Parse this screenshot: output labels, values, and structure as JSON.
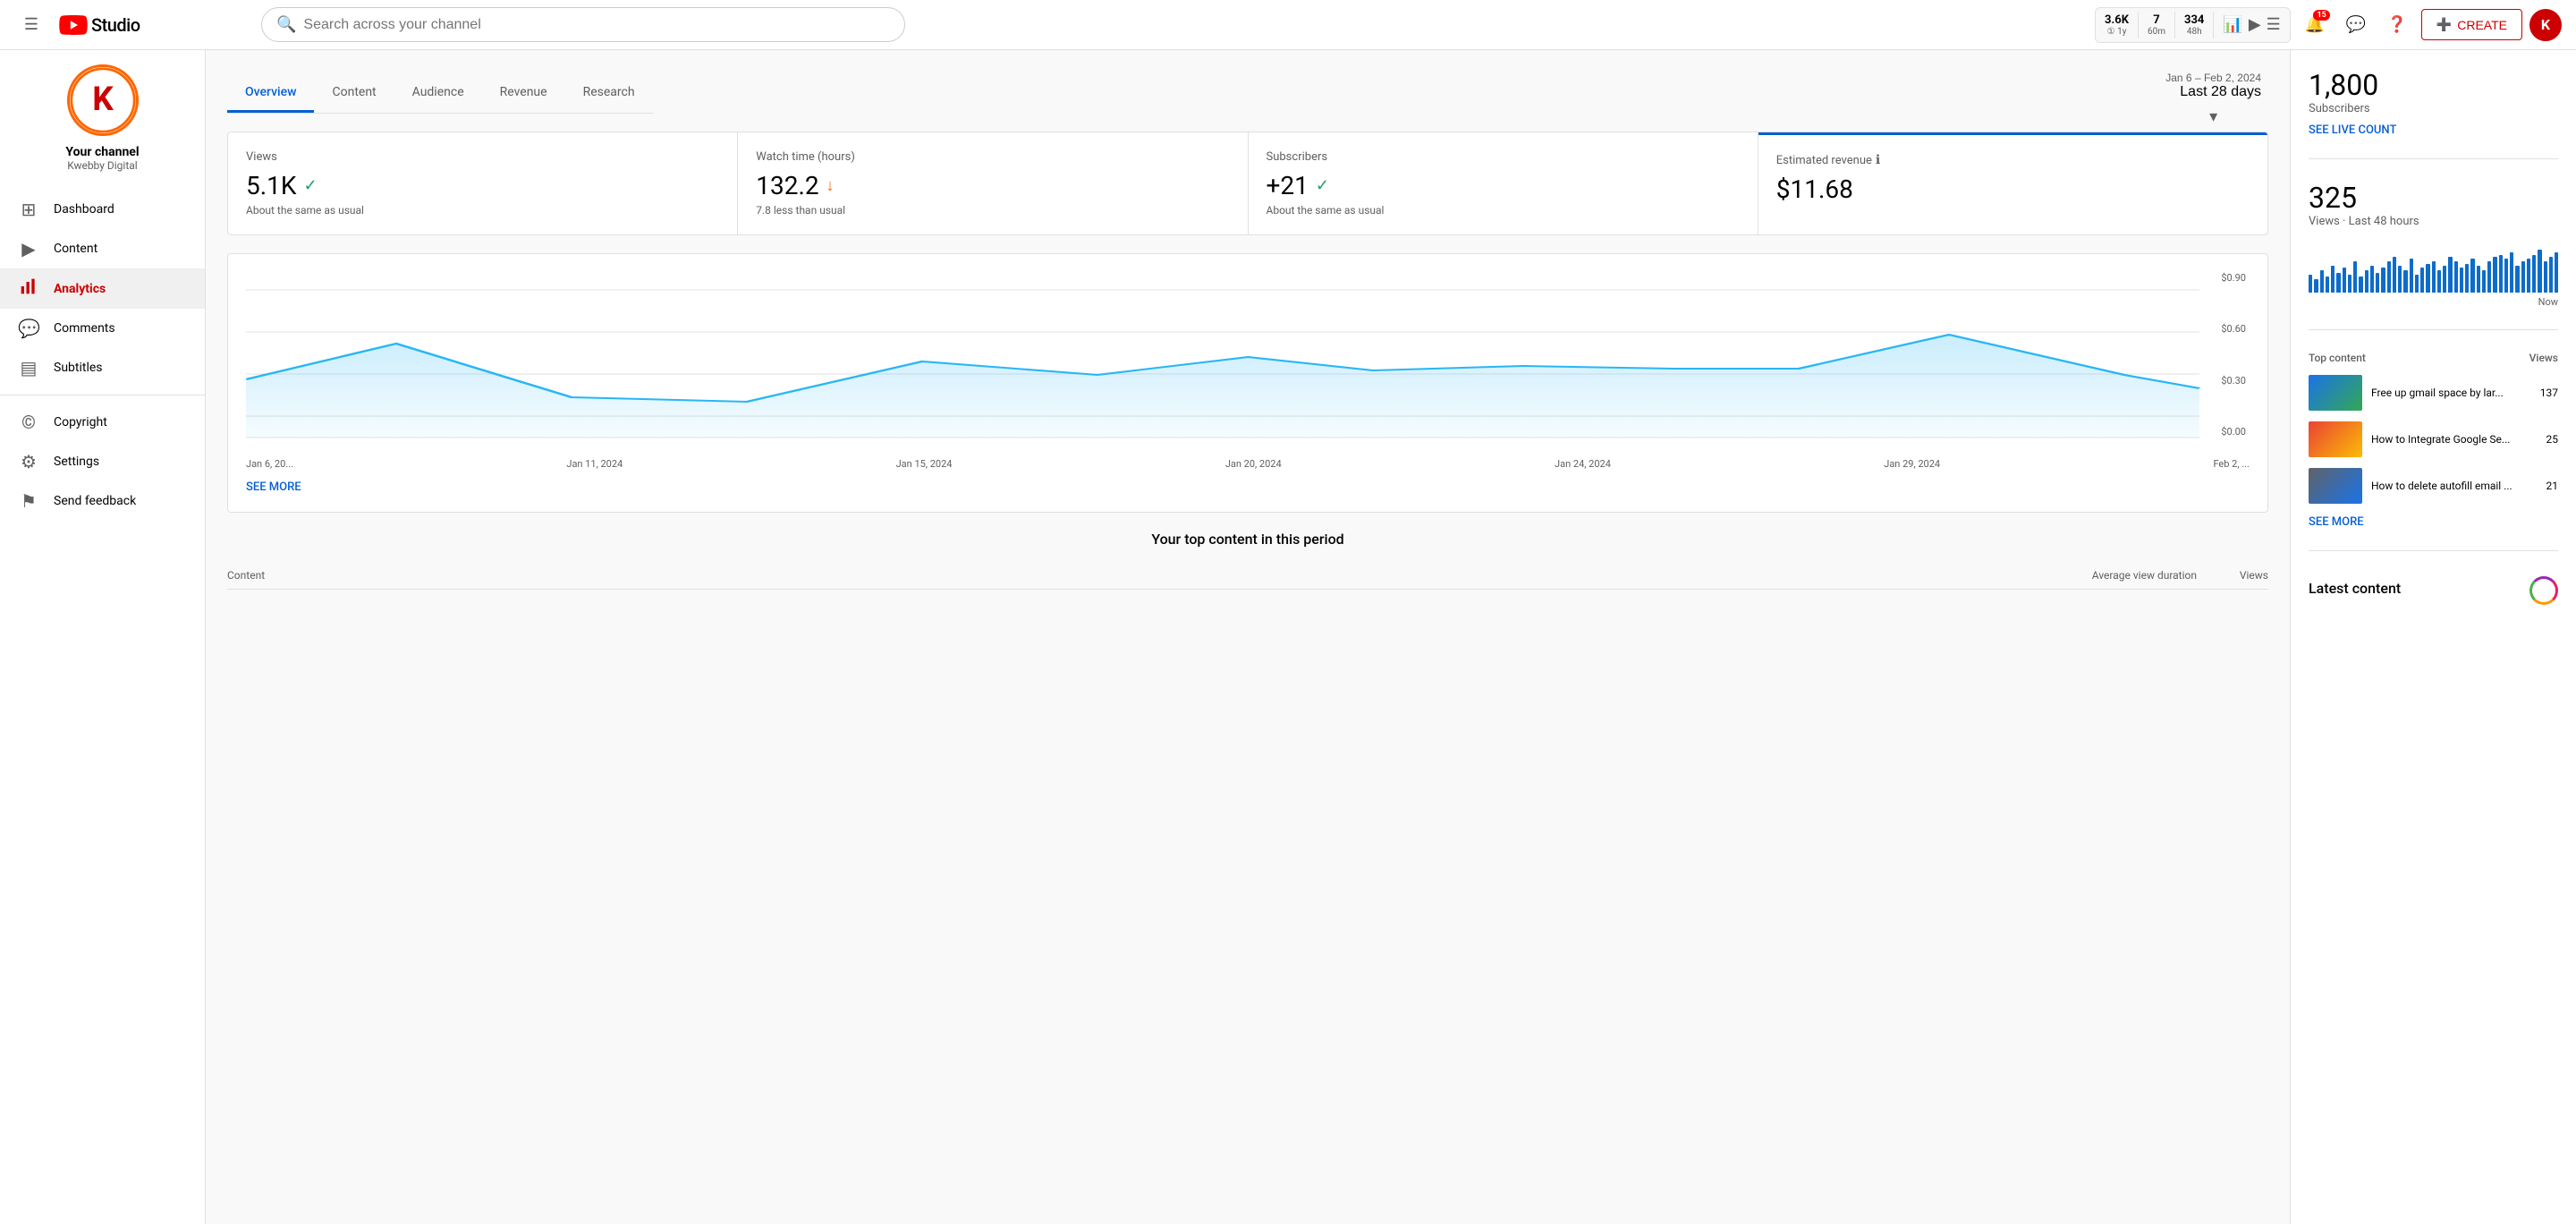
{
  "header": {
    "logo_text": "Studio",
    "search_placeholder": "Search across your channel",
    "stats": {
      "views": "3.6K",
      "views_sub": "① 1y",
      "watch": "7",
      "watch_sub": "60m",
      "notifications": "334",
      "notifications_sub": "48h"
    },
    "notification_count": "15",
    "create_label": "CREATE"
  },
  "channel": {
    "name": "Your channel",
    "handle": "Kwebby Digital",
    "avatar_letter": "K"
  },
  "sidebar": {
    "items": [
      {
        "id": "dashboard",
        "label": "Dashboard",
        "icon": "⊞"
      },
      {
        "id": "content",
        "label": "Content",
        "icon": "▶"
      },
      {
        "id": "analytics",
        "label": "Analytics",
        "icon": "📊"
      },
      {
        "id": "comments",
        "label": "Comments",
        "icon": "💬"
      },
      {
        "id": "subtitles",
        "label": "Subtitles",
        "icon": "▤"
      },
      {
        "id": "copyright",
        "label": "Copyright",
        "icon": "©"
      },
      {
        "id": "settings",
        "label": "Settings",
        "icon": "⚙"
      },
      {
        "id": "feedback",
        "label": "Send feedback",
        "icon": "⚑"
      }
    ]
  },
  "analytics": {
    "tabs": [
      "Overview",
      "Content",
      "Audience",
      "Revenue",
      "Research"
    ],
    "active_tab": "Overview",
    "date_range": {
      "label": "Jan 6 – Feb 2, 2024",
      "value": "Last 28 days"
    },
    "stats": {
      "views": {
        "title": "Views",
        "value": "5.1K",
        "change": "About the same as usual",
        "status": "same"
      },
      "watch_time": {
        "title": "Watch time (hours)",
        "value": "132.2",
        "change": "7.8 less than usual",
        "status": "down"
      },
      "subscribers": {
        "title": "Subscribers",
        "value": "+21",
        "change": "About the same as usual",
        "status": "same"
      },
      "revenue": {
        "title": "Estimated revenue",
        "value": "$11.68",
        "info": true
      }
    },
    "chart": {
      "x_labels": [
        "Jan 6, 20...",
        "Jan 11, 2024",
        "Jan 15, 2024",
        "Jan 20, 2024",
        "Jan 24, 2024",
        "Jan 29, 2024",
        "Feb 2, ..."
      ],
      "y_labels": [
        "$0.90",
        "$0.60",
        "$0.30",
        "$0.00"
      ]
    },
    "see_more_chart": "SEE MORE",
    "top_content_title": "Your top content in this period",
    "table_headers": {
      "content": "Content",
      "avg_view_duration": "Average view duration",
      "views": "Views"
    }
  },
  "right_sidebar": {
    "subscribers": {
      "value": "1,800",
      "label": "Subscribers",
      "live_count_link": "SEE LIVE COUNT"
    },
    "views_48h": {
      "value": "325",
      "label": "Views · Last 48 hours",
      "now_label": "Now"
    },
    "top_content": {
      "title": "Top content",
      "views_col": "Views",
      "items": [
        {
          "title": "Free up gmail space by lar...",
          "views": "137",
          "thumb": "gmail"
        },
        {
          "title": "How to Integrate Google Se...",
          "views": "25",
          "thumb": "google"
        },
        {
          "title": "How to delete autofill email ...",
          "views": "21",
          "thumb": "autofill"
        }
      ],
      "see_more": "SEE MORE"
    },
    "latest_content": {
      "title": "Latest content"
    }
  }
}
